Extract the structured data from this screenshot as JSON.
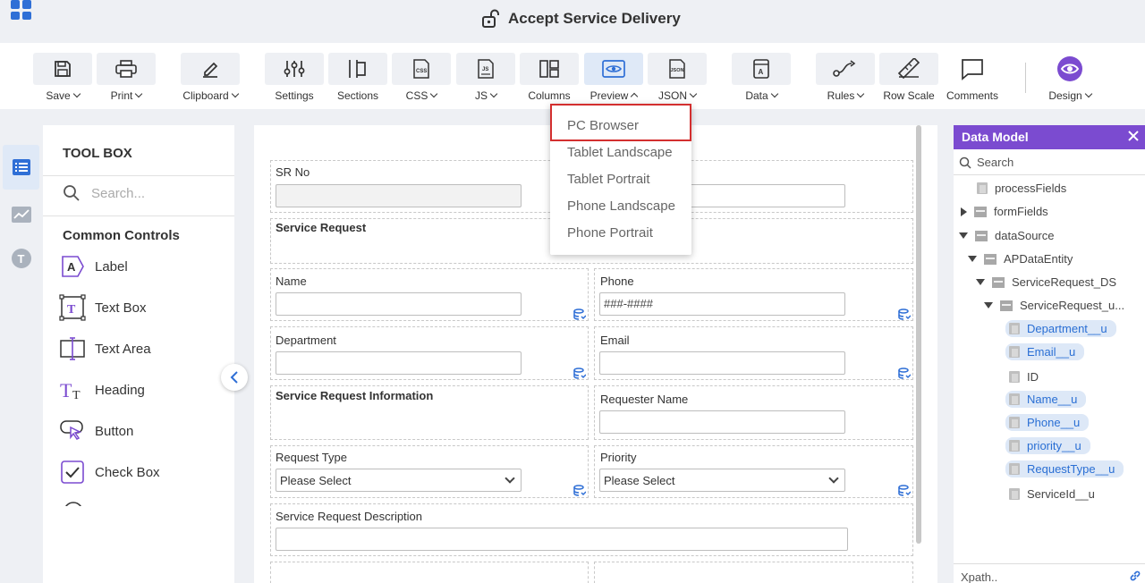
{
  "header": {
    "title": "Accept Service Delivery"
  },
  "toolbar": {
    "save": "Save",
    "print": "Print",
    "clipboard": "Clipboard",
    "settings": "Settings",
    "sections": "Sections",
    "css": "CSS",
    "js": "JS",
    "columns": "Columns",
    "preview": "Preview",
    "json": "JSON",
    "data": "Data",
    "rules": "Rules",
    "row_scale": "Row Scale",
    "comments": "Comments",
    "design": "Design"
  },
  "preview_menu": {
    "items": [
      "PC Browser",
      "Tablet Landscape",
      "Tablet Portrait",
      "Phone Landscape",
      "Phone Portrait"
    ],
    "highlighted": "PC Browser"
  },
  "toolbox": {
    "title": "TOOL BOX",
    "search_placeholder": "Search...",
    "section": "Common Controls",
    "controls": [
      "Label",
      "Text Box",
      "Text Area",
      "Heading",
      "Button",
      "Check Box"
    ]
  },
  "form": {
    "sr_no": "SR No",
    "service_request": "Service Request",
    "name": "Name",
    "phone": "Phone",
    "phone_value": "###-####",
    "department": "Department",
    "email": "Email",
    "sr_information": "Service Request Information",
    "requester_name": "Requester Name",
    "request_type": "Request Type",
    "request_type_value": "Please Select",
    "priority": "Priority",
    "priority_value": "Please Select",
    "sr_description": "Service Request Description"
  },
  "data_model": {
    "title": "Data Model",
    "search_placeholder": "Search",
    "nodes": [
      {
        "label": "processFields"
      },
      {
        "label": "formFields"
      },
      {
        "label": "dataSource"
      },
      {
        "label": "APDataEntity"
      },
      {
        "label": "ServiceRequest_DS"
      },
      {
        "label": "ServiceRequest_u..."
      },
      {
        "label": "Department__u"
      },
      {
        "label": "Email__u"
      },
      {
        "label": "ID"
      },
      {
        "label": "Name__u"
      },
      {
        "label": "Phone__u"
      },
      {
        "label": "priority__u"
      },
      {
        "label": "RequestType__u"
      },
      {
        "label": "ServiceId__u"
      }
    ],
    "xpath": "Xpath.."
  },
  "colors": {
    "accent": "#2f6fd6",
    "panel_header": "#7b4bd0",
    "highlight_border": "#d32f2f"
  }
}
